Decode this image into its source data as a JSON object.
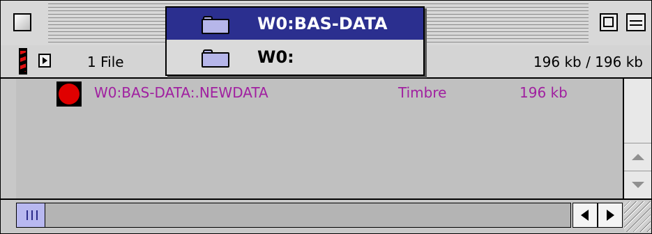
{
  "window": {
    "path_menu": [
      {
        "label": "W0:BAS-DATA",
        "selected": true,
        "icon": "folder-icon"
      },
      {
        "label": "W0:",
        "selected": false,
        "icon": "folder-icon"
      }
    ]
  },
  "info_bar": {
    "file_count": "1 File",
    "size_info": "196 kb / 196 kb"
  },
  "files": [
    {
      "name": "W0:BAS-DATA:.NEWDATA",
      "kind": "Timbre",
      "size": "196 kb",
      "icon": "red-circle-icon",
      "color": "#a020a0"
    }
  ],
  "colors": {
    "selection": "#2b2f8f",
    "file_text": "#a020a0",
    "file_icon": "#e00000"
  }
}
